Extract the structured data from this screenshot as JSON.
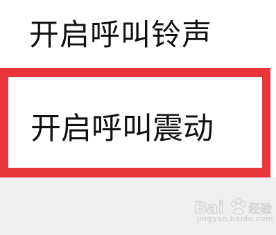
{
  "settings": {
    "items": [
      {
        "label": "开启呼叫铃声"
      },
      {
        "label": "开启呼叫震动"
      }
    ]
  },
  "highlight": {
    "color": "#e8353a"
  },
  "watermark": {
    "logo_text": "Bai",
    "brand_suffix": "经验",
    "url": "jingyan.baidu.com"
  }
}
